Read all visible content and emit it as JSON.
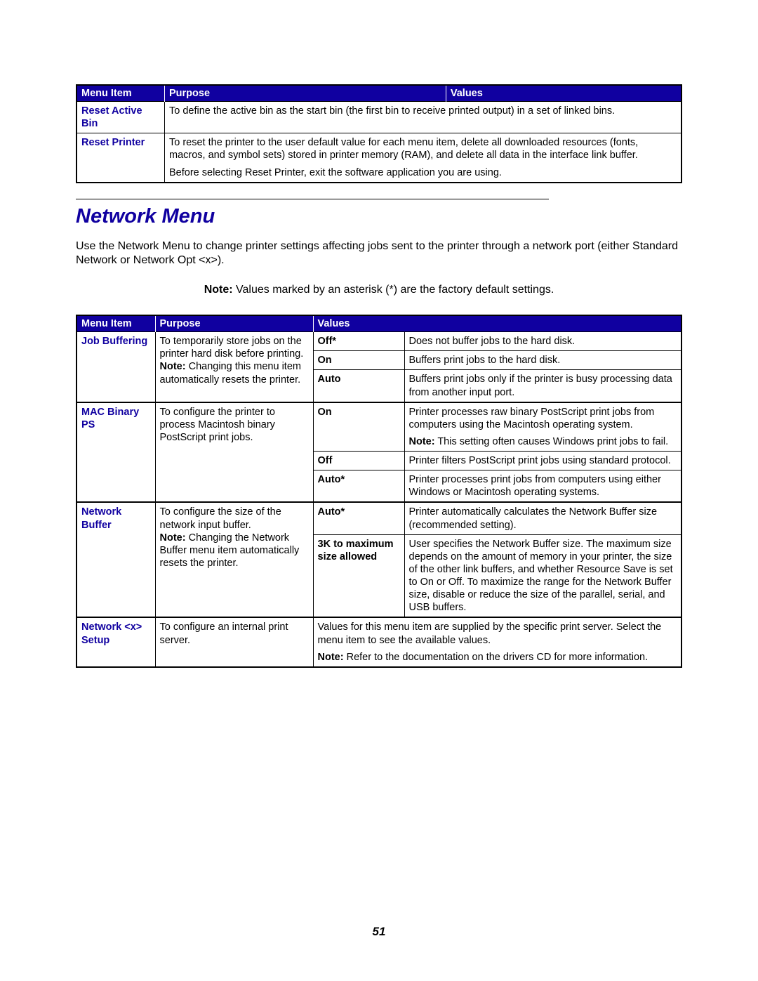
{
  "table1": {
    "headers": [
      "Menu Item",
      "Purpose",
      "Values"
    ],
    "rows": [
      {
        "item": "Reset Active Bin",
        "purpose": "To define the active bin as the start bin (the first bin to receive printed output) in a set of linked bins."
      },
      {
        "item": "Reset Printer",
        "purpose_p1": "To reset the printer to the user default value for each menu item, delete all downloaded resources (fonts, macros, and symbol sets) stored in printer memory (RAM), and delete all data in the interface link buffer.",
        "purpose_p2": "Before selecting Reset Printer, exit the software application you are using."
      }
    ]
  },
  "section": {
    "title": "Network Menu",
    "intro": "Use the Network Menu to change printer settings affecting jobs sent to the printer through a network port (either Standard Network or Network Opt <x>).",
    "note_label": "Note:",
    "note_text": " Values marked by an asterisk (*) are the factory default settings."
  },
  "table2": {
    "headers": [
      "Menu Item",
      "Purpose",
      "Values"
    ],
    "job_buffering": {
      "item": "Job Buffering",
      "purpose_p1": "To temporarily store jobs on the printer hard disk before printing.",
      "purpose_note_label": "Note:",
      "purpose_note_text": " Changing this menu item automatically resets the printer.",
      "v1_label": "Off*",
      "v1_desc": "Does not buffer jobs to the hard disk.",
      "v2_label": "On",
      "v2_desc": "Buffers print jobs to the hard disk.",
      "v3_label": "Auto",
      "v3_desc": "Buffers print jobs only if the printer is busy processing data from another input port."
    },
    "mac_binary": {
      "item": "MAC Binary PS",
      "purpose": "To configure the printer to process Macintosh binary PostScript print jobs.",
      "v1_label": "On",
      "v1_desc_p1": "Printer processes raw binary PostScript print jobs from computers using the Macintosh operating system.",
      "v1_desc_note_label": "Note:",
      "v1_desc_note_text": " This setting often causes Windows print jobs to fail.",
      "v2_label": "Off",
      "v2_desc": "Printer filters PostScript print jobs using standard protocol.",
      "v3_label": "Auto*",
      "v3_desc": "Printer processes print jobs from computers using either Windows or Macintosh operating systems."
    },
    "network_buffer": {
      "item": "Network Buffer",
      "purpose_p1": "To configure the size of the network input buffer.",
      "purpose_note_label": "Note:",
      "purpose_note_text": " Changing the Network Buffer menu item automatically resets the printer.",
      "v1_label": "Auto*",
      "v1_desc": "Printer automatically calculates the Network Buffer size (recommended setting).",
      "v2_label": "3K to maximum size allowed",
      "v2_desc": "User specifies the Network Buffer size. The maximum size depends on the amount of memory in your printer, the size of the other link buffers, and whether Resource Save is set to On or Off. To maximize the range for the Network Buffer size, disable or reduce the size of the parallel, serial, and USB buffers."
    },
    "network_setup": {
      "item": "Network <x> Setup",
      "purpose": "To configure an internal print server.",
      "values_p1": "Values for this menu item are supplied by the specific print server. Select the menu item to see the available values.",
      "values_note_label": "Note:",
      "values_note_text": " Refer to the documentation on the drivers CD for more information."
    }
  },
  "page_number": "51"
}
